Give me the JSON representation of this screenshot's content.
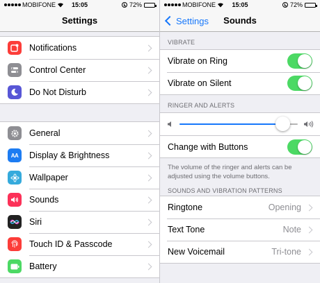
{
  "left": {
    "status": {
      "carrier": "MOBIFONE",
      "time": "15:05",
      "battery": "72%",
      "battery_level": 0.72
    },
    "nav_title": "Settings",
    "group1": [
      {
        "label": "Notifications",
        "icon": "notifications-icon",
        "color": "#fc3d39"
      },
      {
        "label": "Control Center",
        "icon": "control-center-icon",
        "color": "#8e8e93"
      },
      {
        "label": "Do Not Disturb",
        "icon": "do-not-disturb-icon",
        "color": "#5856d6"
      }
    ],
    "group2": [
      {
        "label": "General",
        "icon": "gear-icon",
        "color": "#8e8e93"
      },
      {
        "label": "Display & Brightness",
        "icon": "display-icon",
        "color": "#1d7cf2",
        "glyph": "AA"
      },
      {
        "label": "Wallpaper",
        "icon": "wallpaper-icon",
        "color": "#35aadc"
      },
      {
        "label": "Sounds",
        "icon": "sounds-icon",
        "color": "#fc3158"
      },
      {
        "label": "Siri",
        "icon": "siri-icon",
        "color": "#222222"
      },
      {
        "label": "Touch ID & Passcode",
        "icon": "fingerprint-icon",
        "color": "#fc3d39"
      },
      {
        "label": "Battery",
        "icon": "battery-icon",
        "color": "#4cd964"
      }
    ]
  },
  "right": {
    "status": {
      "carrier": "MOBIFONE",
      "time": "15:05",
      "battery": "72%",
      "battery_level": 0.72
    },
    "back_label": "Settings",
    "nav_title": "Sounds",
    "vibrate_header": "VIBRATE",
    "vibrate_rows": [
      {
        "label": "Vibrate on Ring",
        "on": true
      },
      {
        "label": "Vibrate on Silent",
        "on": true
      }
    ],
    "ringer_header": "RINGER AND ALERTS",
    "volume_level": 0.87,
    "change_with_buttons": {
      "label": "Change with Buttons",
      "on": true
    },
    "ringer_footnote": "The volume of the ringer and alerts can be adjusted using the volume buttons.",
    "patterns_header": "SOUNDS AND VIBRATION PATTERNS",
    "patterns": [
      {
        "label": "Ringtone",
        "value": "Opening"
      },
      {
        "label": "Text Tone",
        "value": "Note"
      },
      {
        "label": "New Voicemail",
        "value": "Tri-tone"
      }
    ]
  },
  "colors": {
    "accent": "#1677fb",
    "toggle_on": "#4cd964"
  }
}
